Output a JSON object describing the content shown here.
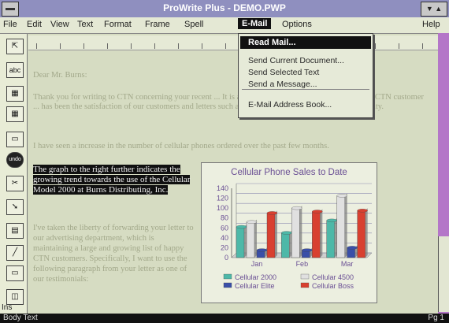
{
  "window": {
    "title": "ProWrite Plus - DEMO.PWP"
  },
  "menubar": [
    {
      "id": "file",
      "label": "File"
    },
    {
      "id": "edit",
      "label": "Edit"
    },
    {
      "id": "view",
      "label": "View"
    },
    {
      "id": "text",
      "label": "Text"
    },
    {
      "id": "format",
      "label": "Format"
    },
    {
      "id": "frame",
      "label": "Frame"
    },
    {
      "id": "spell",
      "label": "Spell"
    },
    {
      "id": "email",
      "label": "E-Mail"
    },
    {
      "id": "options",
      "label": "Options"
    },
    {
      "id": "help",
      "label": "Help"
    }
  ],
  "email_menu": {
    "items": [
      {
        "label": "Read Mail..."
      },
      {
        "label": "Send Current Document..."
      },
      {
        "label": "Send Selected Text"
      },
      {
        "label": "Send a Message..."
      },
      {
        "label": "E-Mail Address Book..."
      }
    ]
  },
  "toolbox": {
    "tools": [
      {
        "icon": "select-arrow-icon",
        "glyph": "⇱"
      },
      {
        "icon": "text-tool-icon",
        "glyph": "abc"
      },
      {
        "icon": "frame-add-icon",
        "glyph": "▦"
      },
      {
        "icon": "frame-add-icon-2",
        "glyph": "▦"
      },
      {
        "icon": "page-icon",
        "glyph": "▭"
      },
      {
        "icon": "undo-icon",
        "glyph": "undo"
      },
      {
        "icon": "scissors-icon",
        "glyph": "✂"
      },
      {
        "icon": "arrow-tool-icon",
        "glyph": "➘"
      },
      {
        "icon": "grid-tool-icon",
        "glyph": "▤"
      },
      {
        "icon": "line-tool-icon",
        "glyph": "╱"
      },
      {
        "icon": "rectangle-tool-icon",
        "glyph": "▭"
      },
      {
        "icon": "page-nav-icon",
        "glyph": "◫"
      }
    ],
    "ins_label": "Ins"
  },
  "document": {
    "salutation": "Dear Mr. Burns:",
    "para1": "Thank you for writing to CTN concerning your recent ... It is always gratifying to hear from a satisfied CTN customer ... has been the satisfaction of our customers and letters such as yours reaffirm our commitment to quality.",
    "para2": "I have seen a increase in the number of cellular phones ordered over the past few months.",
    "highlight": "The graph to the right further indicates the growing trend towards the use of the Cellular Model 2000 at Burns Distributing, Inc.",
    "para3": "I've taken the liberty of forwarding your letter to our advertising department, which is maintaining a large and growing list of happy CTN customers. Specifically, I want to use the following paragraph from your letter as one of our testimonials:"
  },
  "status": {
    "left": "Body Text",
    "right": "Pg 1"
  },
  "chart_data": {
    "type": "bar",
    "title": "Cellular Phone Sales to Date",
    "categories": [
      "Jan",
      "Feb",
      "Mar"
    ],
    "ylim": [
      0,
      140
    ],
    "yticks": [
      0,
      20,
      40,
      60,
      80,
      100,
      120,
      140
    ],
    "series": [
      {
        "name": "Cellular 2000",
        "color": "#4db8a8",
        "values": [
          62,
          50,
          75
        ]
      },
      {
        "name": "Cellular 4500",
        "color": "#e0e0e0",
        "values": [
          72,
          100,
          125
        ]
      },
      {
        "name": "Cellular Elite",
        "color": "#3a4fa8",
        "values": [
          15,
          15,
          20
        ]
      },
      {
        "name": "Cellular Boss",
        "color": "#d84030",
        "values": [
          90,
          93,
          95
        ]
      }
    ],
    "legend": "bottom",
    "grid": true
  }
}
